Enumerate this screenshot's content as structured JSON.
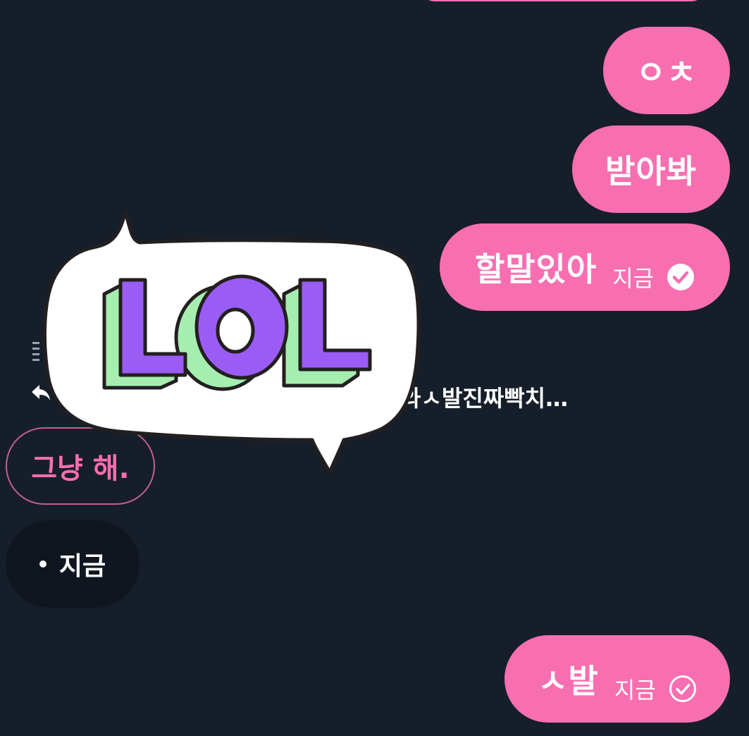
{
  "messages_out": [
    {
      "text": "ㅇㅊ"
    },
    {
      "text": "받아봐"
    },
    {
      "text": "할말있아",
      "time": "지금",
      "read": true
    },
    {
      "text": "ㅅ발",
      "time": "지금",
      "read": false
    }
  ],
  "reply": {
    "preview_text": "와ㅅ발진짜빡치…"
  },
  "quoted_message": {
    "text": "그냥 해."
  },
  "incoming_status": {
    "time": "지금"
  },
  "sticker": {
    "text": "LOL",
    "icon": "lol-sticker"
  },
  "colors": {
    "background": "#161e2a",
    "outgoing_bubble": "#f76fb1",
    "sticker_purple": "#9b5cf6",
    "sticker_green": "#a6eeb0"
  }
}
